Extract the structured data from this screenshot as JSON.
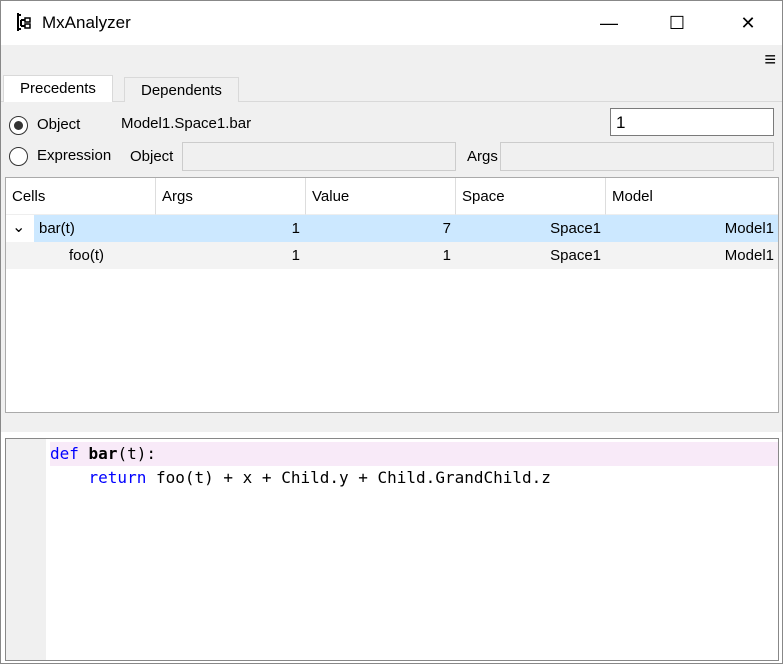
{
  "window": {
    "title": "MxAnalyzer",
    "minimize": "—",
    "maximize": "☐",
    "close": "✕"
  },
  "toolbar": {
    "menu": "≡"
  },
  "tabs": [
    {
      "label": "Precedents",
      "active": true
    },
    {
      "label": "Dependents",
      "active": false
    }
  ],
  "form": {
    "object_radio": "Object",
    "object_value": "Model1.Space1.bar",
    "args_value": "1",
    "expression_radio": "Expression",
    "object_label": "Object",
    "args_label": "Args"
  },
  "table": {
    "columns": [
      "Cells",
      "Args",
      "Value",
      "Space",
      "Model"
    ],
    "rows": [
      {
        "cells": "bar(t)",
        "args": "1",
        "value": "7",
        "space": "Space1",
        "model": "Model1"
      },
      {
        "cells": "foo(t)",
        "args": "1",
        "value": "1",
        "space": "Space1",
        "model": "Model1"
      }
    ]
  },
  "code": {
    "l1_kw": "def",
    "l1_name": "bar",
    "l1_rest": "(t):",
    "l2_kw": "return",
    "l2_rest": " foo(t) + x + Child.y + Child.GrandChild.z"
  }
}
